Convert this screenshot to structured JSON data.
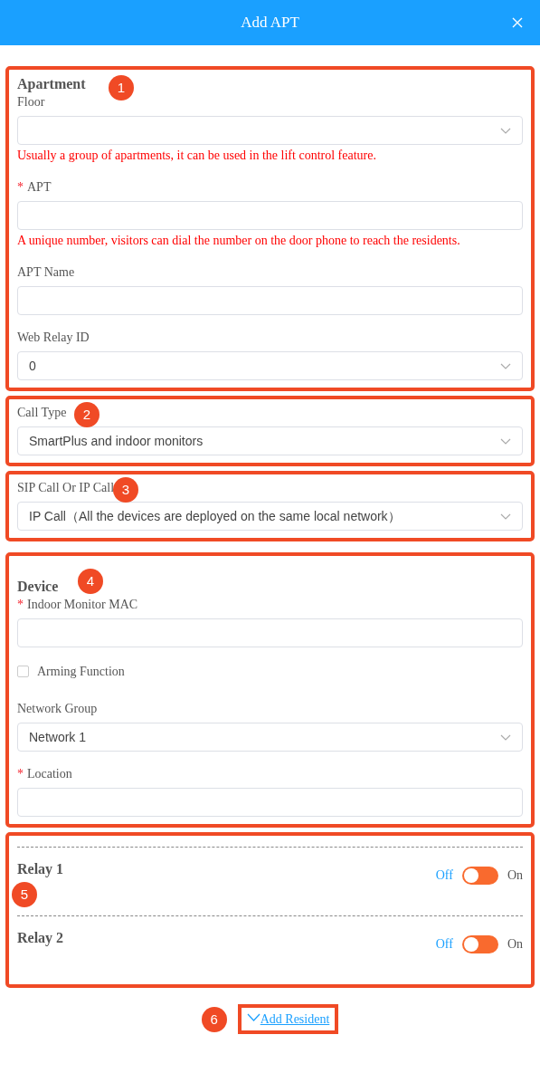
{
  "dialog": {
    "title": "Add APT"
  },
  "sections": [
    {
      "callout": "1",
      "heading": "Apartment",
      "fields": [
        {
          "kind": "select",
          "label": "Floor",
          "hint": "Usually a group of apartments, it can be used in the lift control feature."
        },
        {
          "kind": "input",
          "label": "APT",
          "required_mark": "*",
          "hint": "A unique number, visitors can dial the number on the door phone to reach the residents."
        },
        {
          "kind": "input",
          "label": "APT Name"
        },
        {
          "kind": "select",
          "label": "Web Relay ID",
          "value": "0"
        }
      ]
    },
    {
      "callout": "2",
      "fields": [
        {
          "kind": "select",
          "label": "Call Type",
          "value": "SmartPlus and indoor monitors"
        }
      ]
    },
    {
      "callout": "3",
      "fields": [
        {
          "kind": "select",
          "label": "SIP Call Or IP Call",
          "value": "IP Call（All the devices are deployed on the same local network）"
        }
      ]
    },
    {
      "callout": "4",
      "heading": "Device",
      "fields": [
        {
          "kind": "input",
          "label": "Indoor Monitor MAC",
          "required_mark": "*"
        },
        {
          "kind": "checkbox",
          "label": "Arming Function",
          "checked": false
        },
        {
          "kind": "select",
          "label": "Network Group",
          "value": "Network 1"
        },
        {
          "kind": "input",
          "label": "Location",
          "required_mark": "*"
        }
      ]
    },
    {
      "callout": "5",
      "fields": [
        {
          "kind": "relay",
          "label": "Relay 1",
          "off_label": "Off",
          "on_label": "On",
          "on": false
        },
        {
          "kind": "relay",
          "label": "Relay 2",
          "off_label": "Off",
          "on_label": "On",
          "on": false
        }
      ]
    }
  ],
  "add_resident": {
    "callout": "6",
    "label": "Add Resident"
  }
}
